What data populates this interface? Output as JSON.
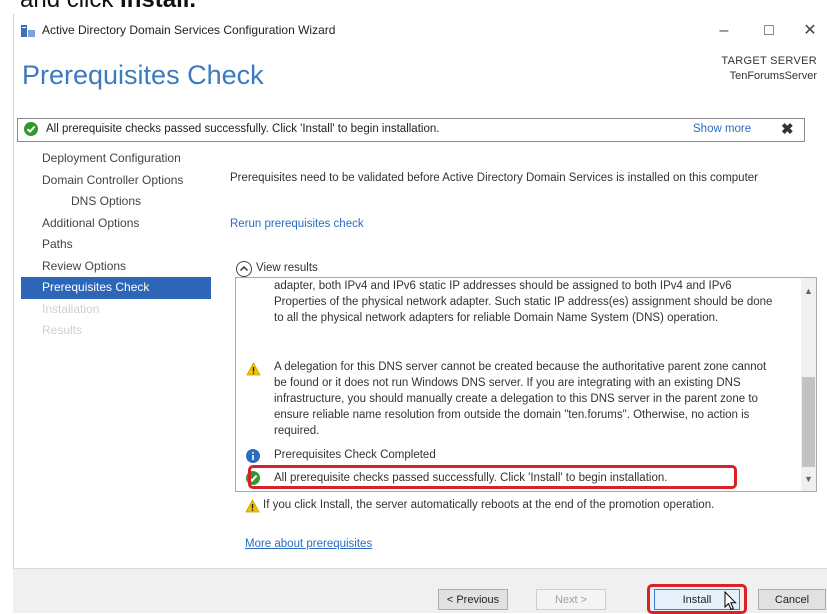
{
  "caption": {
    "prefix": "and click ",
    "emphasis": "Install."
  },
  "window": {
    "title": "Active Directory Domain Services Configuration Wizard",
    "minimize": "–",
    "maximize": "□",
    "close": "✕"
  },
  "header": {
    "page_title": "Prerequisites Check",
    "target_label": "TARGET SERVER",
    "target_server": "TenForumsServer"
  },
  "banner": {
    "message": "All prerequisite checks passed successfully.  Click 'Install' to begin installation.",
    "show_more": "Show more",
    "close": "✖"
  },
  "nav": {
    "items": [
      {
        "label": "Deployment Configuration",
        "state": "normal"
      },
      {
        "label": "Domain Controller Options",
        "state": "normal"
      },
      {
        "label": "DNS Options",
        "state": "indent"
      },
      {
        "label": "Additional Options",
        "state": "normal"
      },
      {
        "label": "Paths",
        "state": "normal"
      },
      {
        "label": "Review Options",
        "state": "normal"
      },
      {
        "label": "Prerequisites Check",
        "state": "active"
      },
      {
        "label": "Installation",
        "state": "disabled"
      },
      {
        "label": "Results",
        "state": "disabled"
      }
    ]
  },
  "content": {
    "intro": "Prerequisites need to be validated before Active Directory Domain Services is installed on this computer",
    "rerun": "Rerun prerequisites check",
    "view_results": "View results",
    "results": {
      "p1": "adapter, both IPv4 and IPv6 static IP addresses should be assigned to both IPv4 and IPv6 Properties of the physical network adapter. Such static IP address(es) assignment should be done to all the physical network adapters for reliable Domain Name System (DNS) operation.",
      "p2": "A delegation for this DNS server cannot be created because the authoritative parent zone cannot be found or it does not run Windows DNS server. If you are integrating with an existing DNS infrastructure, you should manually create a delegation to this DNS server in the parent zone to ensure reliable name resolution from outside the domain \"ten.forums\". Otherwise, no action is required.",
      "p3": "Prerequisites Check Completed",
      "p4": "All prerequisite checks passed successfully.  Click 'Install' to begin installation."
    },
    "warning_footer": "If you click Install, the server automatically reboots at the end of the promotion operation.",
    "more_link": "More about prerequisites"
  },
  "footer": {
    "previous": "< Previous",
    "next": "Next >",
    "install": "Install",
    "cancel": "Cancel"
  },
  "colors": {
    "accent": "#2d66b6",
    "title_blue": "#3b7bbf",
    "link": "#2a6cc0",
    "highlight_red": "#d8222a",
    "success_green": "#2e9a2e",
    "warning_yellow": "#f2c200"
  }
}
